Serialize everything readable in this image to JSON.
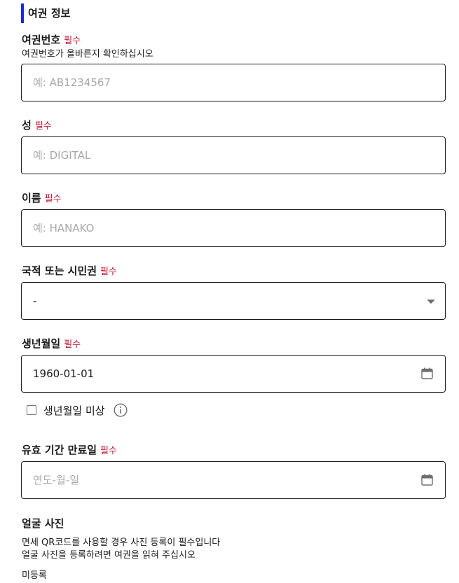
{
  "section": {
    "title": "여권 정보"
  },
  "required_label": "필수",
  "passport": {
    "label": "여권번호",
    "hint": "여권번호가 올바른지 확인하십시오",
    "placeholder": "예: AB1234567"
  },
  "surname": {
    "label": "성",
    "placeholder": "예: DIGITAL"
  },
  "given_name": {
    "label": "이름",
    "placeholder": "예: HANAKO"
  },
  "nationality": {
    "label": "국적 또는 시민권",
    "selected": "-"
  },
  "birthdate": {
    "label": "생년월일",
    "value": "1960-01-01",
    "unknown_checkbox_label": "생년월일 미상",
    "unknown_checked": false
  },
  "expiry": {
    "label": "유효 기간 만료일",
    "placeholder": "연도-월-일"
  },
  "photo": {
    "title": "얼굴 사진",
    "desc_line1": "면세 QR코드를 사용할 경우 사진 등록이 필수입니다",
    "desc_line2": "얼굴 사진을 등록하려면 여권을 읽혀 주십시오",
    "status": "미등록"
  },
  "icons": {
    "select": "chevron-down-icon",
    "date": "calendar-icon",
    "help": "info-icon"
  }
}
